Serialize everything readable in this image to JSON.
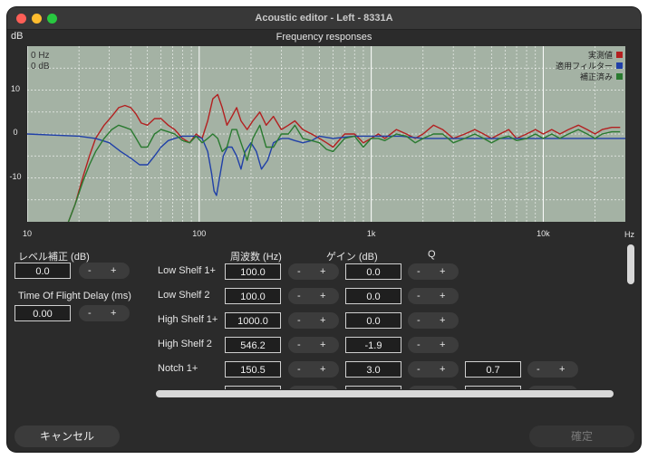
{
  "window": {
    "title": "Acoustic editor - Left - 8331A"
  },
  "chart_data": {
    "type": "line",
    "title": "Frequency responses",
    "ylabel": "dB",
    "xlabel": "Hz",
    "xscale": "log",
    "xlim": [
      10,
      30000
    ],
    "ylim": [
      -20,
      20
    ],
    "x_ticks": [
      10,
      100,
      1000,
      10000
    ],
    "x_tick_labels": [
      "10",
      "100",
      "1k",
      "10k"
    ],
    "y_ticks": [
      10,
      0,
      -10
    ],
    "y_tick_labels": [
      "10",
      "0",
      "-10"
    ],
    "cursor_readout": [
      "0 Hz",
      "0 dB"
    ],
    "grid": true,
    "legend": "top-right",
    "series": [
      {
        "name": "実測値",
        "color": "#b32020",
        "x": [
          17,
          19,
          21,
          23,
          25,
          28,
          31,
          34,
          37,
          40,
          43,
          46,
          50,
          55,
          60,
          66,
          72,
          80,
          88,
          96,
          104,
          112,
          120,
          128,
          136,
          145,
          155,
          165,
          175,
          190,
          205,
          225,
          245,
          270,
          300,
          330,
          360,
          400,
          450,
          500,
          550,
          600,
          700,
          800,
          900,
          1000,
          1100,
          1200,
          1400,
          1600,
          1800,
          2000,
          2300,
          2600,
          3000,
          3500,
          4000,
          4500,
          5000,
          5600,
          6300,
          7000,
          8000,
          9000,
          10000,
          11200,
          12500,
          14000,
          16000,
          18000,
          20000,
          22000,
          25000,
          28000
        ],
        "y": [
          -21,
          -16,
          -10,
          -5,
          -1,
          2,
          4,
          6,
          6.5,
          6,
          4.5,
          2.5,
          2,
          3.5,
          3.5,
          2,
          1,
          -1,
          -2,
          0,
          -1,
          3,
          8,
          9,
          6,
          2,
          4,
          6,
          3,
          1,
          3,
          5,
          2,
          4,
          1,
          2,
          3,
          1,
          0,
          -1,
          -2,
          -3,
          0,
          0,
          -2,
          -1,
          0,
          -1,
          1,
          0,
          -1,
          0,
          2,
          1,
          -1,
          0,
          1,
          0,
          -1,
          0,
          1,
          -1,
          0,
          1,
          0,
          1,
          0,
          1,
          2,
          1,
          0,
          1,
          1.5,
          1.5
        ]
      },
      {
        "name": "適用フィルター",
        "color": "#2040a8",
        "x": [
          10,
          20,
          25,
          30,
          35,
          40,
          45,
          50,
          55,
          60,
          66,
          72,
          80,
          88,
          96,
          104,
          112,
          118,
          122,
          126,
          130,
          138,
          146,
          155,
          165,
          175,
          185,
          200,
          215,
          230,
          250,
          270,
          300,
          330,
          360,
          400,
          450,
          500,
          600,
          800,
          1000,
          1500,
          2000,
          3000,
          5000,
          10000,
          20000,
          30000
        ],
        "y": [
          0,
          -0.5,
          -1,
          -2,
          -4,
          -5.5,
          -7,
          -7,
          -5,
          -3,
          -1.5,
          -1,
          -0.5,
          -0.5,
          -0.5,
          -1,
          -4,
          -9,
          -13,
          -14,
          -11,
          -5,
          -3,
          -3,
          -5,
          -8,
          -4,
          -2,
          -4,
          -8,
          -6,
          -2,
          -1,
          -1,
          -1.5,
          -2,
          -1.5,
          -0.5,
          -1,
          -0.5,
          -0.5,
          -0.5,
          -1,
          -1,
          -1,
          -1,
          -1,
          -1
        ]
      },
      {
        "name": "補正済み",
        "color": "#2a7a30",
        "x": [
          17,
          19,
          21,
          23,
          25,
          28,
          31,
          34,
          37,
          40,
          43,
          46,
          50,
          55,
          60,
          66,
          72,
          80,
          88,
          96,
          104,
          112,
          120,
          128,
          136,
          145,
          155,
          165,
          175,
          190,
          205,
          225,
          245,
          270,
          300,
          330,
          360,
          400,
          450,
          500,
          550,
          600,
          700,
          800,
          900,
          1000,
          1100,
          1200,
          1400,
          1600,
          1800,
          2000,
          2300,
          2600,
          3000,
          3500,
          4000,
          4500,
          5000,
          5600,
          6300,
          7000,
          8000,
          9000,
          10000,
          11200,
          12500,
          14000,
          16000,
          18000,
          20000,
          22000,
          25000,
          28000
        ],
        "y": [
          -21,
          -16,
          -11,
          -7,
          -4,
          -1,
          1,
          2,
          1.5,
          1,
          -1,
          -3,
          -3,
          0,
          1,
          0.5,
          0,
          -1.5,
          -2,
          -0.5,
          -2,
          -1,
          0,
          -1,
          -4,
          -3,
          1,
          1,
          -2,
          -6,
          -1,
          2,
          -3,
          -3,
          0,
          0,
          2,
          -1,
          -1.5,
          -2,
          -3.5,
          -4,
          -1,
          -0.5,
          -3,
          -1,
          -1,
          -1.5,
          0,
          -0.5,
          -2,
          -1,
          0,
          0,
          -2,
          -1,
          0,
          -1,
          -2,
          -1,
          -0.5,
          -1.5,
          -1,
          0,
          -1,
          0,
          -1,
          0,
          1,
          0,
          -1,
          0,
          0.5,
          0.5
        ]
      }
    ]
  },
  "level": {
    "label": "レベル補正 (dB)",
    "value": "0.0"
  },
  "tof": {
    "label": "Time Of Flight Delay (ms)",
    "value": "0.00"
  },
  "stepper": {
    "minus": "-",
    "plus": "+"
  },
  "headers": {
    "freq": "周波数 (Hz)",
    "gain": "ゲイン (dB)",
    "q": "Q"
  },
  "filters": [
    {
      "name": "Low Shelf 1+",
      "freq": "100.0",
      "gain": "0.0"
    },
    {
      "name": "Low Shelf 2",
      "freq": "100.0",
      "gain": "0.0"
    },
    {
      "name": "High Shelf 1+",
      "freq": "1000.0",
      "gain": "0.0"
    },
    {
      "name": "High Shelf 2",
      "freq": "546.2",
      "gain": "-1.9"
    },
    {
      "name": "Notch 1+",
      "freq": "150.5",
      "gain": "3.0",
      "q": "0.7"
    }
  ],
  "buttons": {
    "cancel": "キャンセル",
    "confirm": "確定"
  },
  "colors": {
    "plot_bg": "#a4b2a4",
    "grid": "#ffffff"
  }
}
